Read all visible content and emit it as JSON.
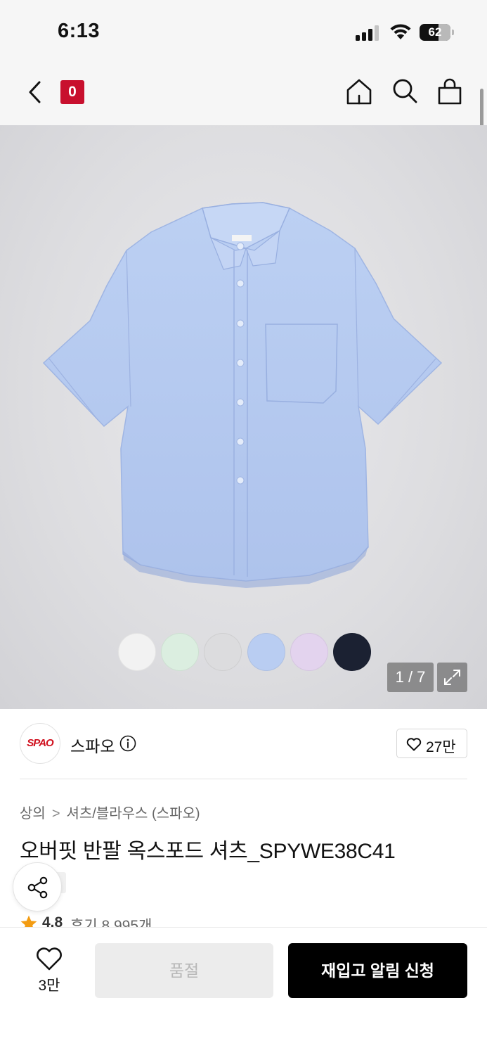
{
  "status_bar": {
    "time": "6:13",
    "battery_level": "62"
  },
  "nav": {
    "brand_badge": "0",
    "icons": [
      "back-icon",
      "home-icon",
      "search-icon",
      "shopping-bag-icon"
    ]
  },
  "gallery": {
    "page_counter": "1 / 7",
    "color_swatches": [
      "#f2f2f2",
      "#dbeee0",
      "#dcdcde",
      "#b9cdf2",
      "#e3d3ee",
      "#1b2132"
    ]
  },
  "brand": {
    "logo_text": "SPAO",
    "name": "스파오",
    "like_count": "27만"
  },
  "breadcrumb": {
    "category": "상의",
    "subcategory": "셔츠/블라우스 (스파오)"
  },
  "product": {
    "title": "오버핏 반팔 옥스포드 셔츠_SPYWE38C41",
    "rating": "4.8",
    "reviews_label": "후기 8,995개"
  },
  "bottom_bar": {
    "wish_count": "3만",
    "sold_out_label": "품절",
    "restock_label": "재입고 알림 신청"
  },
  "colors": {
    "brand_red": "#c8102e",
    "primary_button": "#000000",
    "disabled_button": "#ececec",
    "star": "#f39c12"
  }
}
